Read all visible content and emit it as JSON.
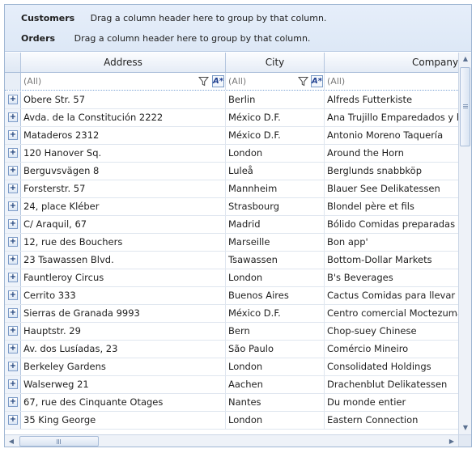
{
  "group_panel": {
    "rows": [
      {
        "name": "Customers",
        "hint": "Drag a column header here to group by that column."
      },
      {
        "name": "Orders",
        "hint": "Drag a column header here to group by that column."
      }
    ]
  },
  "columns": [
    {
      "key": "address",
      "label": "Address"
    },
    {
      "key": "city",
      "label": "City"
    },
    {
      "key": "company",
      "label": "CompanyName"
    }
  ],
  "filter": {
    "address": "(All)",
    "city": "(All)",
    "company": "(All)",
    "operator_glyph": "A*"
  },
  "expander_glyph": "+",
  "rows": [
    {
      "address": "Obere Str. 57",
      "city": "Berlin",
      "company": "Alfreds Futterkiste"
    },
    {
      "address": "Avda. de la Constitución 2222",
      "city": "México D.F.",
      "company": "Ana Trujillo Emparedados y helados"
    },
    {
      "address": "Mataderos  2312",
      "city": "México D.F.",
      "company": "Antonio Moreno Taquería"
    },
    {
      "address": "120 Hanover Sq.",
      "city": "London",
      "company": "Around the Horn"
    },
    {
      "address": "Berguvsvägen  8",
      "city": "Luleå",
      "company": "Berglunds snabbköp"
    },
    {
      "address": "Forsterstr. 57",
      "city": "Mannheim",
      "company": "Blauer See Delikatessen"
    },
    {
      "address": "24, place Kléber",
      "city": "Strasbourg",
      "company": "Blondel père et fils"
    },
    {
      "address": "C/ Araquil, 67",
      "city": "Madrid",
      "company": "Bólido Comidas preparadas"
    },
    {
      "address": "12, rue des Bouchers",
      "city": "Marseille",
      "company": "Bon app'"
    },
    {
      "address": "23 Tsawassen Blvd.",
      "city": "Tsawassen",
      "company": "Bottom-Dollar Markets"
    },
    {
      "address": "Fauntleroy Circus",
      "city": "London",
      "company": "B's Beverages"
    },
    {
      "address": "Cerrito 333",
      "city": "Buenos Aires",
      "company": "Cactus Comidas para llevar"
    },
    {
      "address": "Sierras de Granada 9993",
      "city": "México D.F.",
      "company": "Centro comercial Moctezuma"
    },
    {
      "address": "Hauptstr. 29",
      "city": "Bern",
      "company": "Chop-suey Chinese"
    },
    {
      "address": "Av. dos Lusíadas, 23",
      "city": "São Paulo",
      "company": "Comércio Mineiro"
    },
    {
      "address": "Berkeley Gardens",
      "city": "London",
      "company": "Consolidated Holdings"
    },
    {
      "address": "Walserweg 21",
      "city": "Aachen",
      "company": "Drachenblut Delikatessen"
    },
    {
      "address": "67, rue des Cinquante Otages",
      "city": "Nantes",
      "company": "Du monde entier"
    },
    {
      "address": "35 King George",
      "city": "London",
      "company": "Eastern Connection"
    }
  ]
}
